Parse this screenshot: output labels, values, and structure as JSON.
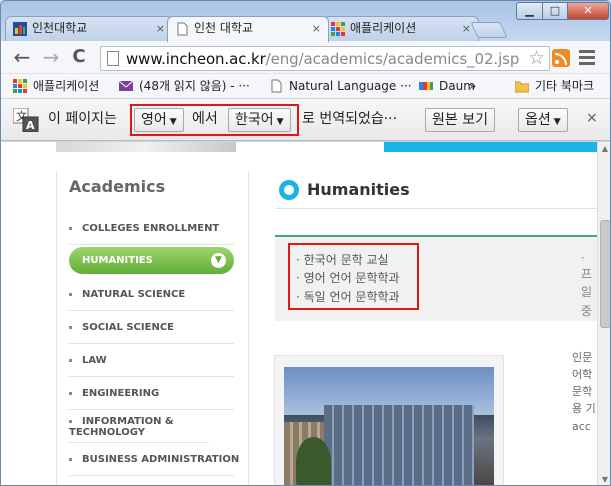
{
  "window": {
    "controls": {
      "minimize": "▁",
      "maximize": "□",
      "close": "✕"
    }
  },
  "tabs": [
    {
      "label": "인천대학교",
      "icon": "incheon-favicon",
      "close": "×"
    },
    {
      "label": "인천 대학교",
      "icon": "page-icon",
      "close": "×"
    },
    {
      "label": "애플리케이션",
      "icon": "apps-icon",
      "close": "×"
    }
  ],
  "toolbar": {
    "back": "←",
    "forward": "→",
    "reload": "C",
    "url_host": "www.incheon.ac.kr",
    "url_path": "/eng/academics/academics_02.jsp",
    "star": "☆"
  },
  "bookmarks": [
    {
      "label": "애플리케이션",
      "icon": "apps-icon"
    },
    {
      "label": "(48개 읽지 않음) - ···",
      "icon": "mail-icon"
    },
    {
      "label": "Natural Language ···",
      "icon": "page-icon"
    },
    {
      "label": "Daum",
      "icon": "daum-icon"
    },
    {
      "label": "»",
      "icon": ""
    },
    {
      "label": "기타 북마크",
      "icon": "folder-icon"
    }
  ],
  "translate_bar": {
    "prefix": "이 페이지는",
    "source_lang": "영어",
    "middle": "에서",
    "target_lang": "한국어",
    "suffix": "로 번역되었습···",
    "show_original": "원본 보기",
    "options": "옵션",
    "close": "×"
  },
  "sidebar": {
    "title": "Academics",
    "items": [
      {
        "label": "COLLEGES  ENROLLMENT",
        "active": false
      },
      {
        "label": "HUMANITIES",
        "active": true
      },
      {
        "label": "NATURAL SCIENCE",
        "active": false
      },
      {
        "label": "SOCIAL SCIENCE",
        "active": false
      },
      {
        "label": "LAW",
        "active": false
      },
      {
        "label": "ENGINEERING",
        "active": false
      },
      {
        "label": "INFORMATION & TECHNOLOGY",
        "active": false
      },
      {
        "label": "BUSINESS ADMINISTRATION",
        "active": false
      }
    ]
  },
  "main": {
    "heading": "Humanities",
    "departments": [
      "· 한국어 문학 교실",
      "· 영어 언어 문학학과",
      "· 독일 언어 문학학과"
    ],
    "departments_right": [
      "· 프",
      "· 일",
      "· 중"
    ],
    "side_text": [
      "인문",
      "어학",
      "문학",
      "용 기",
      "acc"
    ]
  },
  "colors": {
    "accent_cyan": "#19b4e6",
    "active_green": "#5fb035",
    "highlight_red": "#e01818",
    "divider_green": "#4aa57b"
  }
}
